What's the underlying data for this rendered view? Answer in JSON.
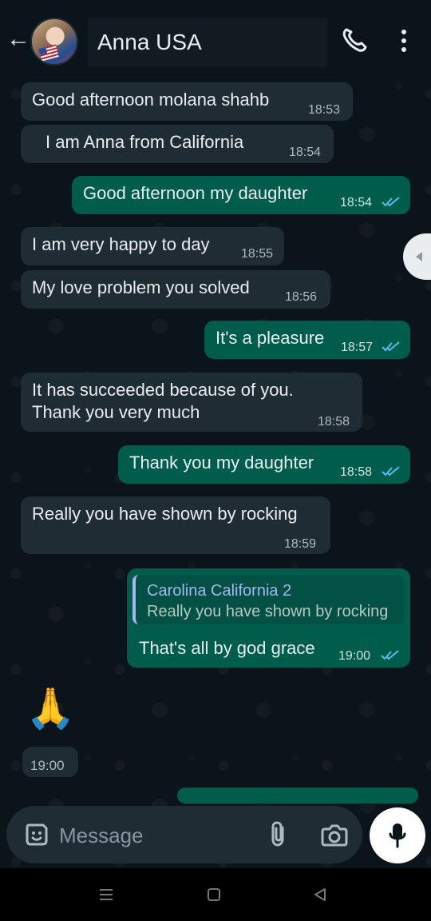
{
  "header": {
    "contact_name": "Anna USA",
    "icons": {
      "back": "arrow-left-icon",
      "call": "phone-icon",
      "menu": "vertical-dots-icon"
    }
  },
  "messages": [
    {
      "direction": "incoming",
      "text": "Good afternoon molana shahb",
      "time": "18:53"
    },
    {
      "direction": "incoming",
      "text": "I am Anna from California",
      "time": "18:54"
    },
    {
      "direction": "outgoing",
      "text": "Good afternoon my daughter",
      "time": "18:54",
      "status": "read"
    },
    {
      "direction": "incoming",
      "text": "I am very happy to day",
      "time": "18:55"
    },
    {
      "direction": "incoming",
      "text": "My love problem you solved",
      "time": "18:56"
    },
    {
      "direction": "outgoing",
      "text": "It's a pleasure",
      "time": "18:57",
      "status": "read"
    },
    {
      "direction": "incoming",
      "text_line_1": "It has succeeded because of you.",
      "text_line_2": "Thank you very much",
      "time": "18:58"
    },
    {
      "direction": "outgoing",
      "text": "Thank you my daughter",
      "time": "18:58",
      "status": "read"
    },
    {
      "direction": "incoming",
      "text": "Really you have shown by rocking",
      "time": "18:59"
    },
    {
      "direction": "outgoing",
      "reply": {
        "sender": "Carolina California 2",
        "text": "Really you have shown by rocking"
      },
      "text": "That's all by god grace",
      "time": "19:00",
      "status": "read"
    },
    {
      "direction": "incoming",
      "emoji": "🙏",
      "time": "19:00"
    }
  ],
  "composer": {
    "placeholder": "Message",
    "icons": {
      "sticker": "sticker-icon",
      "attach": "paperclip-icon",
      "camera": "camera-icon",
      "mic": "microphone-icon"
    }
  },
  "colors": {
    "background": "#0b141a",
    "incoming_bubble": "#202c33",
    "outgoing_bubble": "#005c4b",
    "read_ticks": "#53bdeb"
  }
}
